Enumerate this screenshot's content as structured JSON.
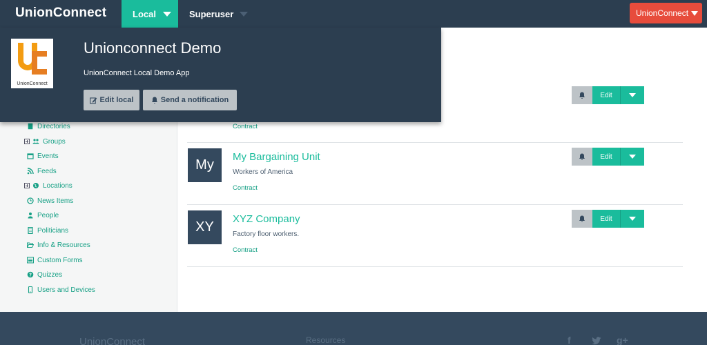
{
  "nav": {
    "brand": "UnionConnect",
    "local_label": "Local",
    "superuser_label": "Superuser",
    "user_label": "UnionConnect"
  },
  "popover": {
    "title": "Unionconnect Demo",
    "subtitle": "UnionConnect Local Demo App",
    "logo_text": "UnionConnect",
    "edit_button": "Edit local",
    "notify_button": "Send a notification"
  },
  "sidebar": {
    "items": [
      {
        "label": "Directories",
        "icon": "book-icon"
      },
      {
        "label": "Groups",
        "icon": "users-icon",
        "expandable": true
      },
      {
        "label": "Events",
        "icon": "calendar-icon"
      },
      {
        "label": "Feeds",
        "icon": "rss-icon"
      },
      {
        "label": "Locations",
        "icon": "globe-icon",
        "expandable": true
      },
      {
        "label": "News Items",
        "icon": "clock-icon"
      },
      {
        "label": "People",
        "icon": "person-icon"
      },
      {
        "label": "Politicians",
        "icon": "building-icon"
      },
      {
        "label": "Info & Resources",
        "icon": "folder-open-icon"
      },
      {
        "label": "Custom Forms",
        "icon": "list-icon"
      },
      {
        "label": "Quizzes",
        "icon": "question-circle-icon"
      },
      {
        "label": "Users and Devices",
        "icon": "mobile-icon"
      }
    ]
  },
  "list": {
    "edit_label": "Edit",
    "rows": [
      {
        "avatar": "",
        "title": "",
        "description": "",
        "tag": "Contract"
      },
      {
        "avatar": "My",
        "title": "My Bargaining Unit",
        "description": "Workers of America",
        "tag": "Contract"
      },
      {
        "avatar": "XY",
        "title": "XYZ Company",
        "description": "Factory floor workers.",
        "tag": "Contract"
      }
    ]
  },
  "footer": {
    "brand": "UnionConnect",
    "resources": "Resources",
    "social": [
      "f",
      "twitter",
      "g+"
    ]
  },
  "colors": {
    "nav_bg": "#2c3e50",
    "accent": "#1abc9c",
    "danger": "#e74c3c",
    "button_grey": "#bdc3c7",
    "sidebar_bg": "#f5f6f6"
  }
}
